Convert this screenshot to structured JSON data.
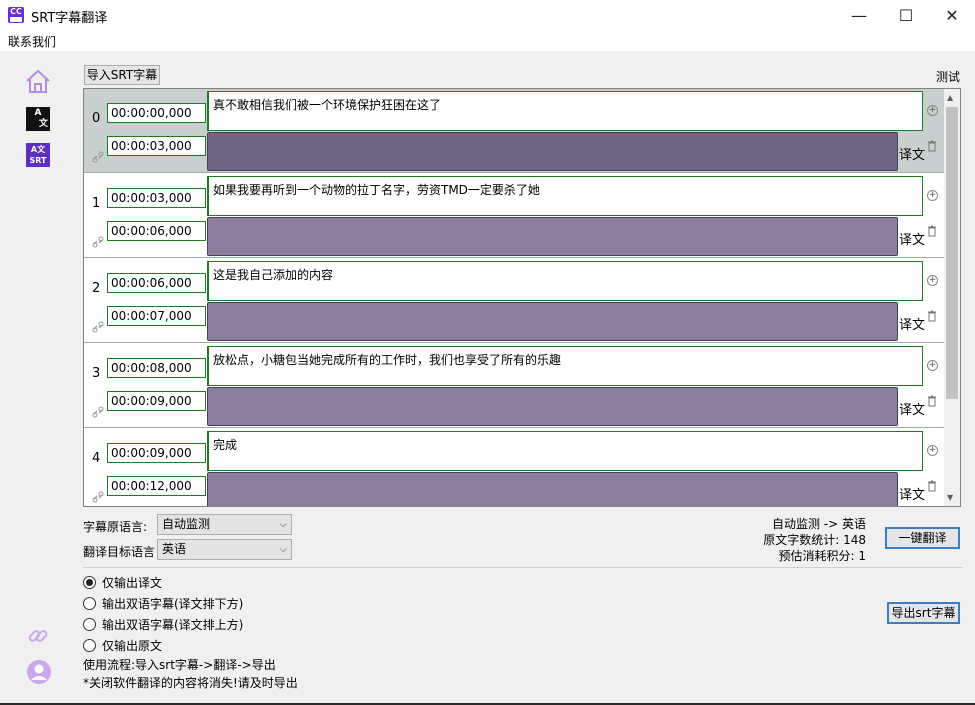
{
  "window": {
    "app_icon_text": "CC",
    "title": "SRT字幕翻译",
    "minimize": "—",
    "maximize": "☐",
    "close": "✕"
  },
  "menu": {
    "contact": "联系我们"
  },
  "sidebar": {
    "icons": [
      "home-icon",
      "translate-icon",
      "srt-icon",
      "link-icon",
      "user-icon"
    ],
    "translate_icon_text": [
      "A",
      "文"
    ],
    "srt_icon_text": [
      "A文",
      "SRT"
    ]
  },
  "toolbar": {
    "import_label": "导入SRT字幕",
    "test_label": "测试"
  },
  "segments": [
    {
      "index": "0",
      "start": "00:00:00,000",
      "end": "00:00:03,000",
      "text": "真不敢相信我们被一个环境保护狂困在这了",
      "translation_label": "译文"
    },
    {
      "index": "1",
      "start": "00:00:03,000",
      "end": "00:00:06,000",
      "text": "如果我要再听到一个动物的拉丁名字，劳资TMD一定要杀了她",
      "translation_label": "译文"
    },
    {
      "index": "2",
      "start": "00:00:06,000",
      "end": "00:00:07,000",
      "text": "这是我自己添加的内容",
      "translation_label": "译文"
    },
    {
      "index": "3",
      "start": "00:00:08,000",
      "end": "00:00:09,000",
      "text": "放松点，小糖包当她完成所有的工作时，我们也享受了所有的乐趣",
      "translation_label": "译文"
    },
    {
      "index": "4",
      "start": "00:00:09,000",
      "end": "00:00:12,000",
      "text": "完成",
      "translation_label": "译文"
    }
  ],
  "language": {
    "source_label": "字幕原语言:",
    "source_value": "自动监测",
    "target_label": "翻译目标语言",
    "target_value": "英语"
  },
  "stats": {
    "direction": "自动监测 -> 英语",
    "char_count": "原文字数统计: 148",
    "cost": "预估消耗积分: 1"
  },
  "buttons": {
    "translate": "一键翻译",
    "export": "导出srt字幕"
  },
  "output_options": [
    {
      "label": "仅输出译文",
      "selected": true
    },
    {
      "label": "输出双语字幕(译文排下方)",
      "selected": false
    },
    {
      "label": "输出双语字幕(译文排上方)",
      "selected": false
    },
    {
      "label": "仅输出原文",
      "selected": false
    }
  ],
  "notes": {
    "workflow": "使用流程:导入srt字幕->翻译->导出",
    "warning": "*关闭软件翻译的内容将消失!请及时导出"
  },
  "colors": {
    "accent": "#3c7fc1",
    "time_border": "#1e7d1e",
    "translation_fill": "#8b7e9c",
    "selected_row": "#c7cfcf",
    "brand_purple": "#6a2bd9"
  }
}
